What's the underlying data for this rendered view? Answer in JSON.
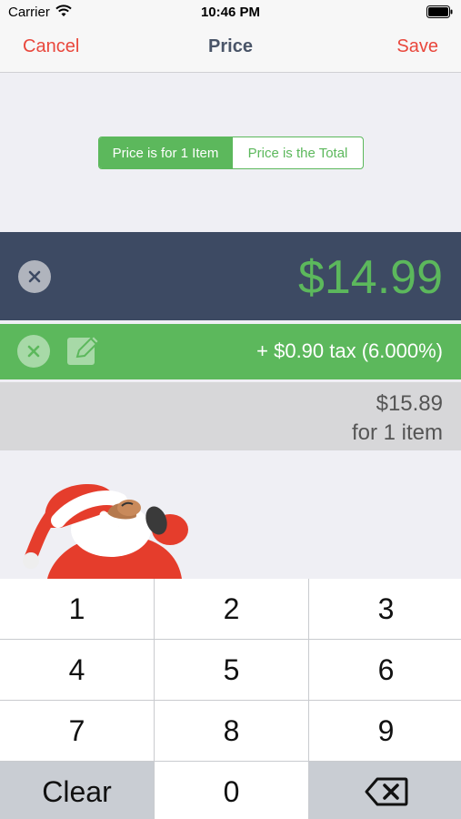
{
  "status_bar": {
    "carrier": "Carrier",
    "time": "10:46 PM",
    "icons": [
      "wifi-icon",
      "battery-icon"
    ]
  },
  "nav": {
    "cancel": "Cancel",
    "title": "Price",
    "save": "Save"
  },
  "segment": {
    "options": [
      "Price is for 1 Item",
      "Price is the Total"
    ],
    "selected": "Price is for 1 Item"
  },
  "price": {
    "value": "$14.99"
  },
  "tax": {
    "text": "+ $0.90 tax (6.000%)"
  },
  "total": {
    "amount": "$15.89",
    "subtitle": "for 1 item"
  },
  "keypad": {
    "keys": [
      "1",
      "2",
      "3",
      "4",
      "5",
      "6",
      "7",
      "8",
      "9",
      "Clear",
      "0"
    ],
    "backspace_icon": "backspace-icon"
  },
  "colors": {
    "accent_red": "#e9473c",
    "green": "#5cb85c",
    "navy": "#3d4a63"
  }
}
